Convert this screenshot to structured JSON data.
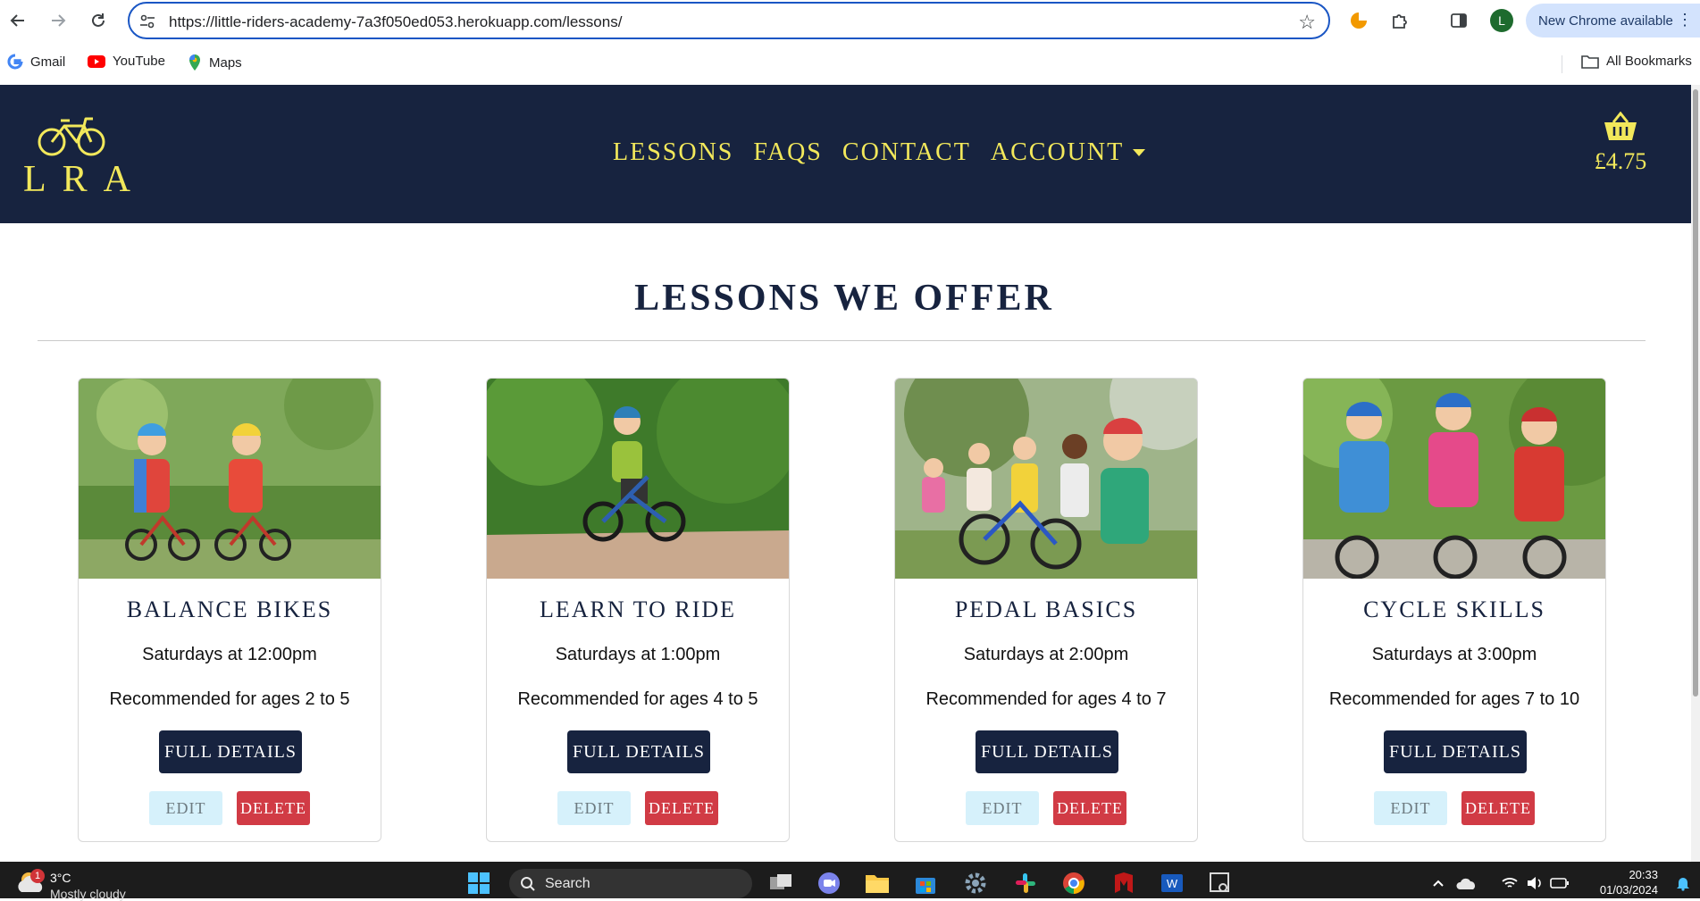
{
  "browser": {
    "url": "https://little-riders-academy-7a3f050ed053.herokuapp.com/lessons/",
    "update_label": "New Chrome available",
    "profile_initial": "L",
    "bookmarks": [
      {
        "label": "Gmail",
        "icon": "google-icon"
      },
      {
        "label": "YouTube",
        "icon": "youtube-icon"
      },
      {
        "label": "Maps",
        "icon": "maps-icon"
      }
    ],
    "all_bookmarks_label": "All Bookmarks"
  },
  "header": {
    "logo_text": "LRA",
    "nav": [
      {
        "label": "LESSONS"
      },
      {
        "label": "FAQS"
      },
      {
        "label": "CONTACT"
      },
      {
        "label": "ACCOUNT",
        "dropdown": true
      }
    ],
    "basket_total": "£4.75",
    "colors": {
      "navy": "#17233f",
      "accent": "#f2e85b"
    }
  },
  "main": {
    "title": "LESSONS WE OFFER",
    "cards": [
      {
        "title": "BALANCE BIKES",
        "schedule": "Saturdays at 12:00pm",
        "ages": "Recommended for ages 2 to 5",
        "details_label": "FULL DETAILS",
        "edit_label": "EDIT",
        "delete_label": "DELETE"
      },
      {
        "title": "LEARN TO RIDE",
        "schedule": "Saturdays at 1:00pm",
        "ages": "Recommended for ages 4 to 5",
        "details_label": "FULL DETAILS",
        "edit_label": "EDIT",
        "delete_label": "DELETE"
      },
      {
        "title": "PEDAL BASICS",
        "schedule": "Saturdays at 2:00pm",
        "ages": "Recommended for ages 4 to 7",
        "details_label": "FULL DETAILS",
        "edit_label": "EDIT",
        "delete_label": "DELETE"
      },
      {
        "title": "CYCLE SKILLS",
        "schedule": "Saturdays at 3:00pm",
        "ages": "Recommended for ages 7 to 10",
        "details_label": "FULL DETAILS",
        "edit_label": "EDIT",
        "delete_label": "DELETE"
      }
    ]
  },
  "taskbar": {
    "weather_temp": "3°C",
    "weather_condition": "Mostly cloudy",
    "notification_count": "1",
    "search_label": "Search",
    "time": "20:33",
    "date": "01/03/2024"
  }
}
